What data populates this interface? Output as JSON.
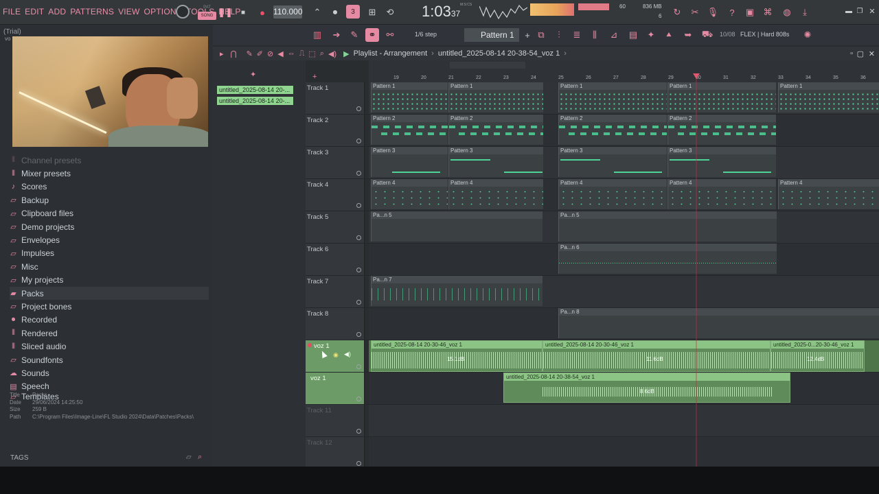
{
  "menu": [
    "FILE",
    "EDIT",
    "ADD",
    "PATTERNS",
    "VIEW",
    "OPTIONS",
    "TOOLS",
    "HELP"
  ],
  "transport": {
    "pat_label": "PAT",
    "song_label": "SONG",
    "tempo": "110.000",
    "time": "1:03",
    "time_sub": "37",
    "time_unit_label": "M:S:CS",
    "cpu": "60",
    "memory": "836 MB",
    "voices": "6"
  },
  "toolbar2": {
    "snap": "1/6 step",
    "pattern": "Pattern 1",
    "hint_num": "10/08",
    "hint_text": "FLEX | Hard 808s"
  },
  "browser": {
    "trial": "(Trial)",
    "vo_label": "vo",
    "items": [
      {
        "label": "Channel presets",
        "icon": "channel-icon"
      },
      {
        "label": "Mixer presets",
        "icon": "mixer-icon"
      },
      {
        "label": "Scores",
        "icon": "note-icon"
      },
      {
        "label": "Backup",
        "icon": "folder-icon"
      },
      {
        "label": "Clipboard files",
        "icon": "folder-icon"
      },
      {
        "label": "Demo projects",
        "icon": "folder-icon"
      },
      {
        "label": "Envelopes",
        "icon": "folder-icon"
      },
      {
        "label": "Impulses",
        "icon": "folder-icon"
      },
      {
        "label": "Misc",
        "icon": "folder-icon"
      },
      {
        "label": "My projects",
        "icon": "folder-icon"
      },
      {
        "label": "Packs",
        "icon": "packs-icon"
      },
      {
        "label": "Project bones",
        "icon": "folder-icon"
      },
      {
        "label": "Recorded",
        "icon": "recorded-icon"
      },
      {
        "label": "Rendered",
        "icon": "rendered-icon"
      },
      {
        "label": "Sliced audio",
        "icon": "sliced-icon"
      },
      {
        "label": "Soundfonts",
        "icon": "soundfont-icon"
      },
      {
        "label": "Sounds",
        "icon": "cloud-icon"
      },
      {
        "label": "Speech",
        "icon": "speech-icon"
      },
      {
        "label": "Templates",
        "icon": "folder-icon"
      }
    ],
    "info": [
      {
        "k": "Title",
        "v": "Packs"
      },
      {
        "k": "Date",
        "v": "29/06/2024 14:25:50"
      },
      {
        "k": "Size",
        "v": "259 B"
      },
      {
        "k": "Path",
        "v": "C:\\Program Files\\Image-Line\\FL Studio 2024\\Data\\Patches\\Packs\\"
      }
    ],
    "tags_label": "TAGS"
  },
  "playlist": {
    "title": "Playlist - Arrangement",
    "project": "untitled_2025-08-14 20-38-54_voz 1",
    "picker": [
      "untitled_2025-08-14 20-...",
      "untitled_2025-08-14 20-..."
    ],
    "ruler": [
      "19",
      "20",
      "21",
      "22",
      "23",
      "24",
      "25",
      "26",
      "27",
      "28",
      "29",
      "30",
      "31",
      "32",
      "33",
      "34",
      "35",
      "36"
    ],
    "tracks": [
      "Track 1",
      "Track 2",
      "Track 3",
      "Track 4",
      "Track 5",
      "Track 6",
      "Track 7",
      "Track 8",
      "voz 1",
      "voz 1",
      "Track 11",
      "Track 12"
    ],
    "pattern_labels": [
      "Pattern 1",
      "Pattern 2",
      "Pattern 3",
      "Pattern 4",
      "Pa...n 5",
      "Pa...n 6",
      "Pa...7",
      "Pa...n 7",
      "Pa...n 8"
    ],
    "audio": [
      {
        "label": "untitled_2025-08-14 20-30-46_voz 1",
        "db": "15.1dB"
      },
      {
        "label": "untitled_2025-08-14 20-30-46_voz 1",
        "db": "11.6dB"
      },
      {
        "label": "untitled_2025-0...20-30-46_voz 1",
        "db": "12.4dB"
      },
      {
        "label": "untitled_2025-08-14 20-38-54_voz 1",
        "db": "8.6dB"
      }
    ]
  },
  "colors": {
    "accent": "#ea8fa8",
    "pattern_note": "#54d49b",
    "audio_clip": "#8bc484",
    "playhead": "#e2576f"
  }
}
